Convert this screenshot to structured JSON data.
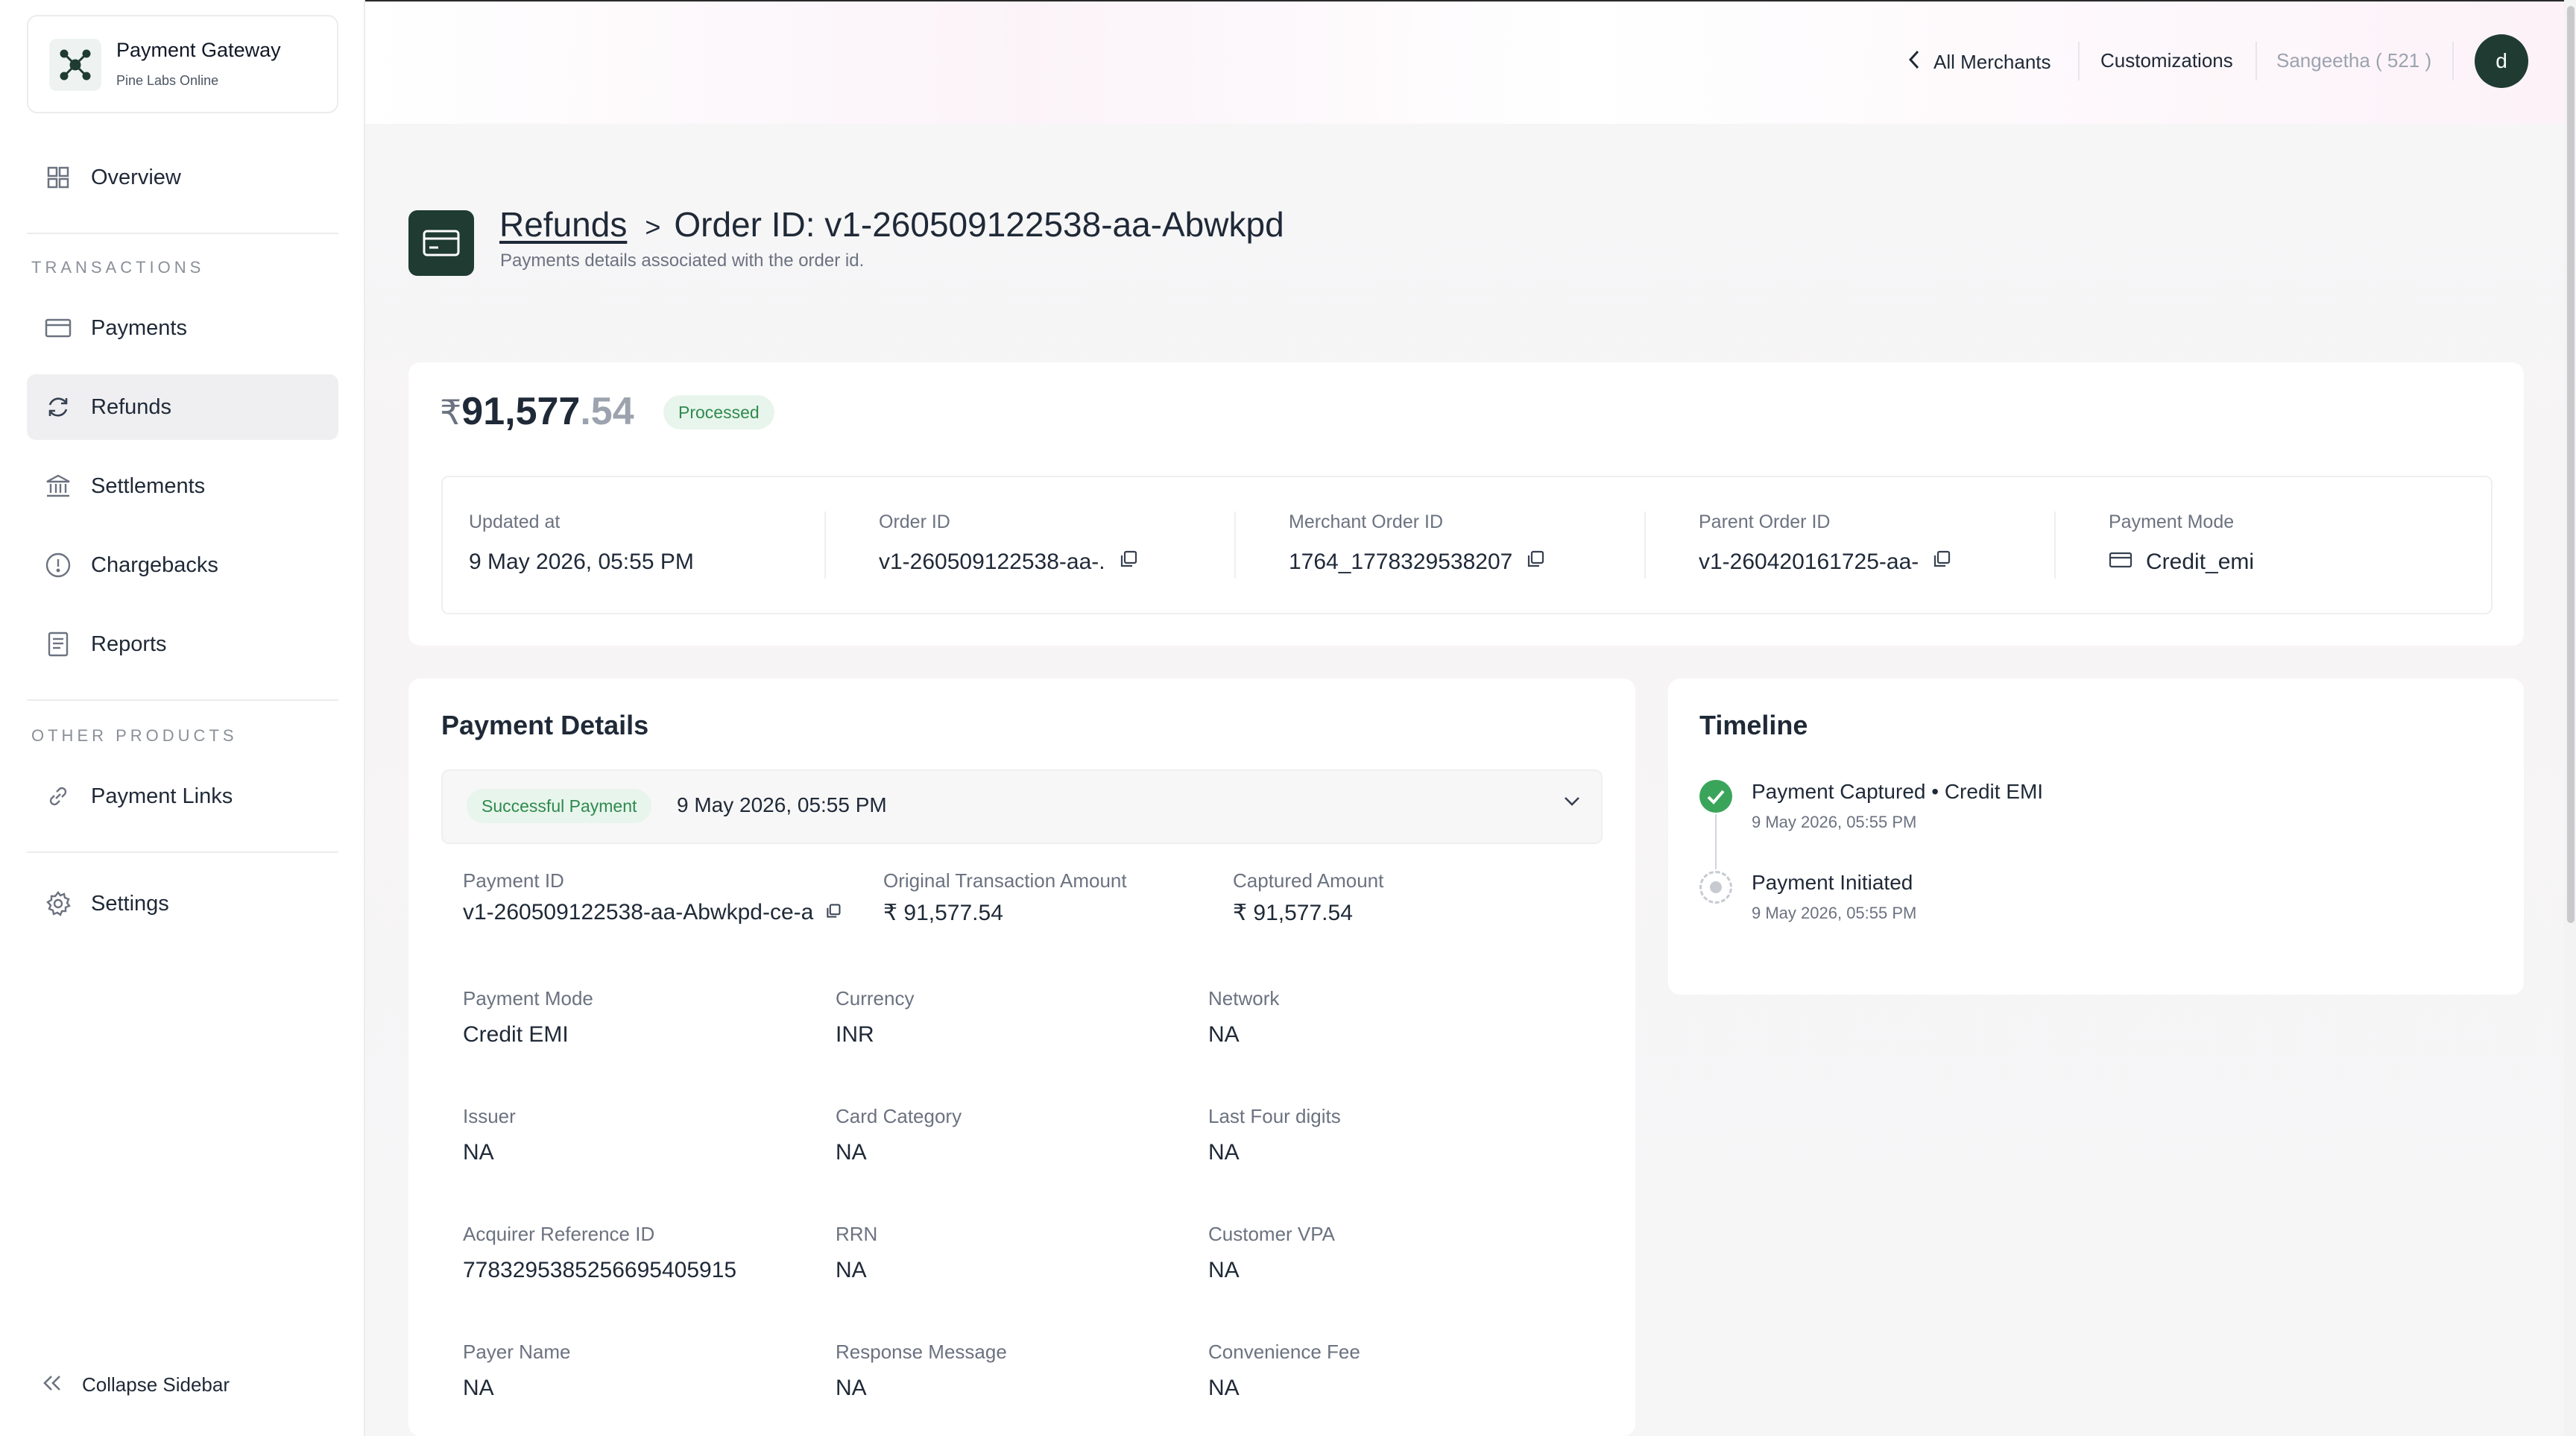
{
  "brand": {
    "title": "Payment Gateway",
    "subtitle": "Pine Labs Online"
  },
  "sidebar": {
    "overview": "Overview",
    "section_transactions": "TRANSACTIONS",
    "items": [
      {
        "label": "Payments",
        "icon": "card-icon"
      },
      {
        "label": "Refunds",
        "icon": "refund-icon",
        "active": true
      },
      {
        "label": "Settlements",
        "icon": "bank-icon"
      },
      {
        "label": "Chargebacks",
        "icon": "alert-icon"
      },
      {
        "label": "Reports",
        "icon": "report-icon"
      }
    ],
    "section_other": "OTHER PRODUCTS",
    "payment_links": "Payment Links",
    "settings": "Settings",
    "collapse": "Collapse Sidebar"
  },
  "topbar": {
    "all_merchants": "All Merchants",
    "customizations": "Customizations",
    "user": "Sangeetha ( 521 )",
    "avatar_initial": "d"
  },
  "page": {
    "breadcrumb_link": "Refunds",
    "breadcrumb_sep": ">",
    "breadcrumb_current": "Order ID: v1-260509122538-aa-Abwkpd",
    "subtitle": "Payments details associated with the order id."
  },
  "summary": {
    "currency_symbol": "₹",
    "amount_int": "91,577",
    "amount_dec": ".54",
    "status": "Processed",
    "fields": [
      {
        "label": "Updated at",
        "value": "9 May 2026, 05:55 PM"
      },
      {
        "label": "Order ID",
        "value": "v1-260509122538-aa-."
      },
      {
        "label": "Merchant Order ID",
        "value": "1764_1778329538207"
      },
      {
        "label": "Parent Order ID",
        "value": "v1-260420161725-aa-"
      },
      {
        "label": "Payment Mode",
        "value": "Credit_emi"
      }
    ]
  },
  "payment_details": {
    "title": "Payment Details",
    "status_badge": "Successful Payment",
    "date": "9 May 2026, 05:55 PM",
    "row1": [
      {
        "label": "Payment ID",
        "value": "v1-260509122538-aa-Abwkpd-ce-a"
      },
      {
        "label": "Original Transaction Amount",
        "value": "₹ 91,577.54"
      },
      {
        "label": "Captured Amount",
        "value": "₹ 91,577.54"
      }
    ],
    "grid": [
      {
        "label": "Payment Mode",
        "value": "Credit EMI"
      },
      {
        "label": "Currency",
        "value": "INR"
      },
      {
        "label": "Network",
        "value": "NA"
      },
      {
        "label": "Issuer",
        "value": "NA"
      },
      {
        "label": "Card Category",
        "value": "NA"
      },
      {
        "label": "Last Four digits",
        "value": "NA"
      },
      {
        "label": "Acquirer Reference ID",
        "value": "77832953852566954059​15"
      },
      {
        "label": "RRN",
        "value": "NA"
      },
      {
        "label": "Customer VPA",
        "value": "NA"
      },
      {
        "label": "Payer Name",
        "value": "NA"
      },
      {
        "label": "Response Message",
        "value": "NA"
      },
      {
        "label": "Convenience Fee",
        "value": "NA"
      }
    ]
  },
  "timeline": {
    "title": "Timeline",
    "events": [
      {
        "title": "Payment Captured • Credit EMI",
        "time": "9 May 2026, 05:55 PM",
        "state": "done"
      },
      {
        "title": "Payment Initiated",
        "time": "9 May 2026, 05:55 PM",
        "state": "pending"
      }
    ]
  },
  "colors": {
    "brand_dark": "#1f3b32",
    "success_bg": "#e8f5ec",
    "success_text": "#2f8a4e"
  }
}
